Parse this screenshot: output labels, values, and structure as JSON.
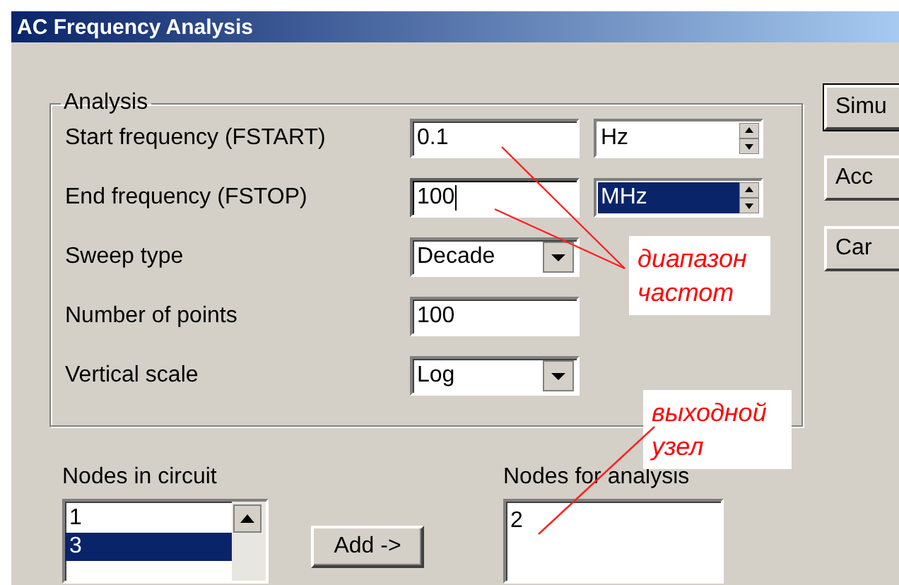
{
  "window": {
    "title": "AC Frequency Analysis"
  },
  "analysis": {
    "title": "Analysis",
    "rows": [
      {
        "kind": "value-unit",
        "label": "Start frequency (FSTART)",
        "value": "0.1",
        "unit": "Hz",
        "unit_selected": false,
        "focused": false
      },
      {
        "kind": "value-unit",
        "label": "End frequency (FSTOP)",
        "value": "100",
        "unit": "MHz",
        "unit_selected": true,
        "focused": true
      },
      {
        "kind": "dropdown",
        "label": "Sweep type",
        "value": "Decade"
      },
      {
        "kind": "field",
        "label": "Number of points",
        "value": "100"
      },
      {
        "kind": "dropdown",
        "label": "Vertical scale",
        "value": "Log"
      }
    ]
  },
  "buttons": [
    "Simu",
    "Acc",
    "Car"
  ],
  "nodes_in_circuit": {
    "label": "Nodes in circuit",
    "items": [
      {
        "text": "1",
        "selected": false
      },
      {
        "text": "3",
        "selected": true
      }
    ]
  },
  "add_button": "Add ->",
  "nodes_for_analysis": {
    "label": "Nodes for analysis",
    "items": [
      {
        "text": "2"
      }
    ]
  },
  "annotations": [
    {
      "text": "диапазон частот"
    },
    {
      "text": "выходной узел"
    }
  ]
}
